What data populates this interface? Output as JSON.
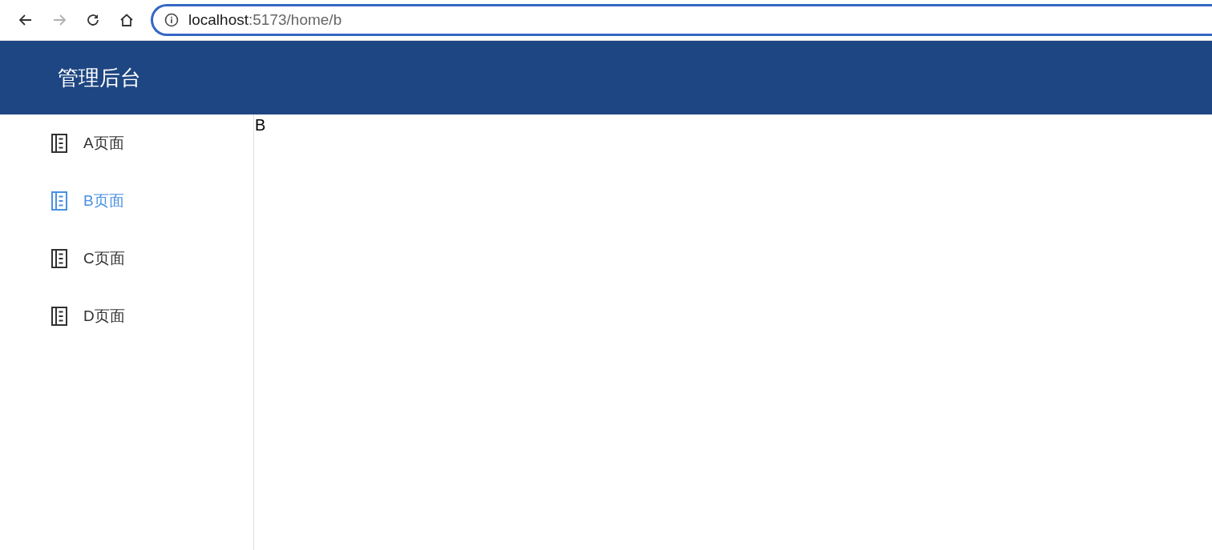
{
  "browser": {
    "back": {
      "disabled": false
    },
    "forward": {
      "disabled": true
    },
    "address": {
      "host": "localhost",
      "path": ":5173/home/b"
    }
  },
  "header": {
    "title": "管理后台"
  },
  "sidebar": {
    "items": [
      {
        "label": "A页面",
        "selected": false
      },
      {
        "label": "B页面",
        "selected": true
      },
      {
        "label": "C页面",
        "selected": false
      },
      {
        "label": "D页面",
        "selected": false
      }
    ]
  },
  "content": {
    "text": "B"
  }
}
